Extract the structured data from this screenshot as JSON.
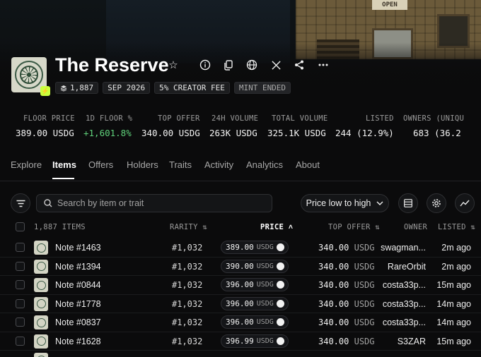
{
  "banner": {
    "sign_text": "OPEN"
  },
  "collection": {
    "name": "The Reserve",
    "chips": {
      "supply": "1,887",
      "date": "SEP 2026",
      "fee": "5% CREATOR FEE",
      "status": "MINT ENDED"
    }
  },
  "header_icons": [
    "star-icon",
    "info-icon",
    "copy-icon",
    "globe-icon",
    "x-icon",
    "share-icon",
    "more-icon"
  ],
  "stats": [
    {
      "label": "FLOOR PRICE",
      "value": "389.00 USDG"
    },
    {
      "label": "1D FLOOR %",
      "value": "+1,601.8%"
    },
    {
      "label": "TOP OFFER",
      "value": "340.00 USDG"
    },
    {
      "label": "24H VOLUME",
      "value": "263K USDG"
    },
    {
      "label": "TOTAL VOLUME",
      "value": "325.1K USDG"
    },
    {
      "label": "LISTED",
      "value": "244 (12.9%)"
    },
    {
      "label": "OWNERS (UNIQU",
      "value": "683 (36.2"
    }
  ],
  "tabs": [
    "Explore",
    "Items",
    "Offers",
    "Holders",
    "Traits",
    "Activity",
    "Analytics",
    "About"
  ],
  "active_tab": "Items",
  "toolbar": {
    "search_placeholder": "Search by item or trait",
    "sort_label": "Price low to high"
  },
  "table": {
    "headers": {
      "items": "1,887 ITEMS",
      "rarity": "RARITY",
      "price": "PRICE",
      "top_offer": "TOP OFFER",
      "owner": "OWNER",
      "listed": "LISTED"
    },
    "rows": [
      {
        "name": "Note #1463",
        "rarity": "#1,032",
        "price": "389.00",
        "price_unit": "USDG",
        "offer": "340.00",
        "offer_unit": "USDG",
        "owner": "swagman...",
        "listed": "2m ago"
      },
      {
        "name": "Note #1394",
        "rarity": "#1,032",
        "price": "390.00",
        "price_unit": "USDG",
        "offer": "340.00",
        "offer_unit": "USDG",
        "owner": "RareOrbit",
        "listed": "2m ago"
      },
      {
        "name": "Note #0844",
        "rarity": "#1,032",
        "price": "396.00",
        "price_unit": "USDG",
        "offer": "340.00",
        "offer_unit": "USDG",
        "owner": "costa33p...",
        "listed": "15m ago"
      },
      {
        "name": "Note #1778",
        "rarity": "#1,032",
        "price": "396.00",
        "price_unit": "USDG",
        "offer": "340.00",
        "offer_unit": "USDG",
        "owner": "costa33p...",
        "listed": "14m ago"
      },
      {
        "name": "Note #0837",
        "rarity": "#1,032",
        "price": "396.00",
        "price_unit": "USDG",
        "offer": "340.00",
        "offer_unit": "USDG",
        "owner": "costa33p...",
        "listed": "14m ago"
      },
      {
        "name": "Note #1628",
        "rarity": "#1,032",
        "price": "396.99",
        "price_unit": "USDG",
        "offer": "340.00",
        "offer_unit": "USDG",
        "owner": "S3ZAR",
        "listed": "15m ago"
      }
    ]
  },
  "colors": {
    "accent_green": "#5fd07a",
    "verified_badge": "#c9ff3d",
    "background": "#0b0b0c"
  }
}
